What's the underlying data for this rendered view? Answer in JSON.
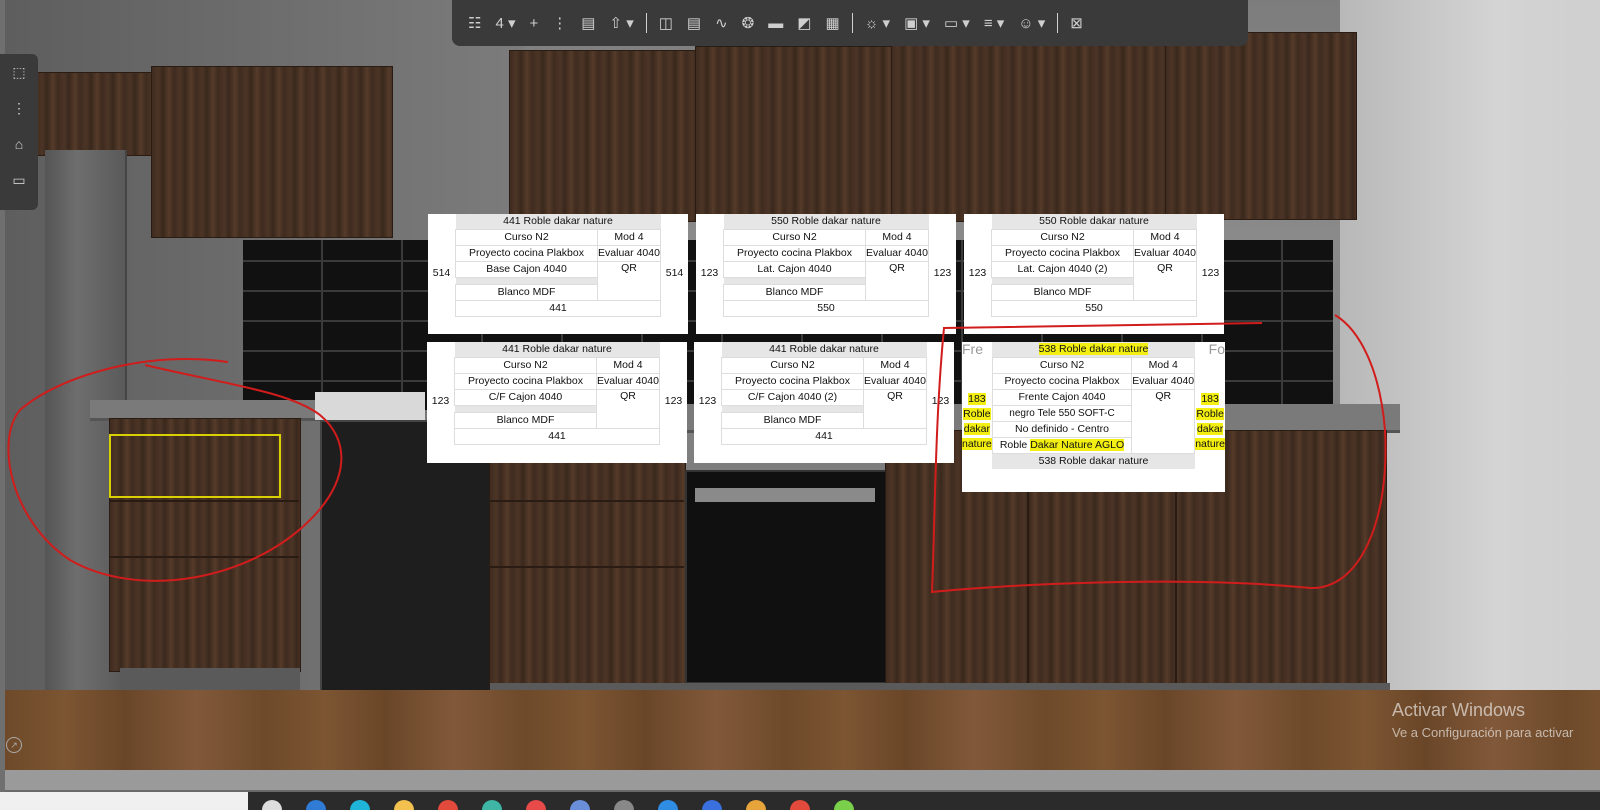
{
  "toolbar": {
    "items": [
      {
        "name": "grid-icon",
        "glyph": "☷"
      },
      {
        "name": "view-count",
        "glyph": "4 ▾"
      },
      {
        "name": "plus-icon",
        "glyph": "+"
      },
      {
        "name": "more-vertical-icon",
        "glyph": "⋮"
      },
      {
        "name": "document-icon",
        "glyph": "▤"
      },
      {
        "name": "export-icon",
        "glyph": "⇧ ▾"
      },
      {
        "name": "separator"
      },
      {
        "name": "layout-icon",
        "glyph": "◫"
      },
      {
        "name": "report-icon",
        "glyph": "▤"
      },
      {
        "name": "curve-icon",
        "glyph": "∿"
      },
      {
        "name": "bulb-icon",
        "glyph": "❂"
      },
      {
        "name": "screen-icon",
        "glyph": "▬"
      },
      {
        "name": "ruler-icon",
        "glyph": "◩"
      },
      {
        "name": "hatch-icon",
        "glyph": "▦"
      },
      {
        "name": "separator"
      },
      {
        "name": "sun-icon",
        "glyph": "☼ ▾"
      },
      {
        "name": "camera-icon",
        "glyph": "▣ ▾"
      },
      {
        "name": "video-icon",
        "glyph": "▭ ▾"
      },
      {
        "name": "lines-icon",
        "glyph": "≡ ▾"
      },
      {
        "name": "users-icon",
        "glyph": "☺ ▾"
      },
      {
        "name": "separator"
      },
      {
        "name": "close-icon",
        "glyph": "⊠"
      }
    ]
  },
  "leftpanel": {
    "items": [
      {
        "name": "node-icon",
        "glyph": "⬚"
      },
      {
        "name": "more-vertical-icon",
        "glyph": "⋮"
      },
      {
        "name": "home-icon",
        "glyph": "⌂"
      },
      {
        "name": "monitor-icon",
        "glyph": "▭"
      }
    ]
  },
  "cards": [
    {
      "header": "441 Roble dakar nature",
      "course": "Curso N2",
      "mod": "Mod 4",
      "project": "Proyecto cocina Plakbox",
      "eval": "Evaluar 4040",
      "part": "Base Cajon 4040",
      "qr": "QR",
      "side_left": "514",
      "side_right": "514",
      "material": "Blanco MDF",
      "footer": "441"
    },
    {
      "header": "550 Roble dakar nature",
      "course": "Curso N2",
      "mod": "Mod 4",
      "project": "Proyecto cocina Plakbox",
      "eval": "Evaluar 4040",
      "part": "Lat. Cajon 4040",
      "qr": "QR",
      "side_left": "123",
      "side_right": "123",
      "material": "Blanco MDF",
      "footer": "550"
    },
    {
      "header": "550 Roble dakar nature",
      "course": "Curso N2",
      "mod": "Mod 4",
      "project": "Proyecto cocina Plakbox",
      "eval": "Evaluar 4040",
      "part": "Lat. Cajon 4040 (2)",
      "qr": "QR",
      "side_left": "123",
      "side_right": "123",
      "material": "Blanco MDF",
      "footer": "550"
    },
    {
      "header": "441 Roble dakar nature",
      "course": "Curso N2",
      "mod": "Mod 4",
      "project": "Proyecto cocina Plakbox",
      "eval": "Evaluar 4040",
      "part": "C/F Cajon 4040",
      "qr": "QR",
      "side_left": "123",
      "side_right": "123",
      "material": "Blanco MDF",
      "footer": "441"
    },
    {
      "header": "441 Roble dakar nature",
      "course": "Curso N2",
      "mod": "Mod 4",
      "project": "Proyecto cocina Plakbox",
      "eval": "Evaluar 4040",
      "part": "C/F Cajon 4040 (2)",
      "qr": "QR",
      "side_left": "123",
      "side_right": "123",
      "material": "Blanco MDF",
      "footer": "441"
    }
  ],
  "card6": {
    "corner_left": "Fre",
    "corner_right": "Fo",
    "header": "538 Roble dakar nature",
    "course": "Curso N2",
    "mod": "Mod 4",
    "project": "Proyecto cocina Plakbox",
    "eval": "Evaluar 4040",
    "part": "Frente Cajon 4040",
    "qr": "QR",
    "side_left_num": "183",
    "side_left_lines": [
      "Roble",
      "dakar",
      "nature"
    ],
    "side_right_num": "183",
    "side_right_lines": [
      "Roble",
      "dakar",
      "nature"
    ],
    "handle": "negro Tele 550 SOFT-C",
    "position": "No definido - Centro",
    "core": "Roble Dakar Nature AGLO",
    "footer": "538 Roble dakar nature",
    "highlight_color": "#f3ef13"
  },
  "watermark": {
    "title": "Activar Windows",
    "subtitle": "Ve a Configuración para activar"
  },
  "colors": {
    "annotation_red": "#d11c1c",
    "toolbar_bg": "#3a3a3a",
    "selection_yellow": "#d8d000"
  }
}
